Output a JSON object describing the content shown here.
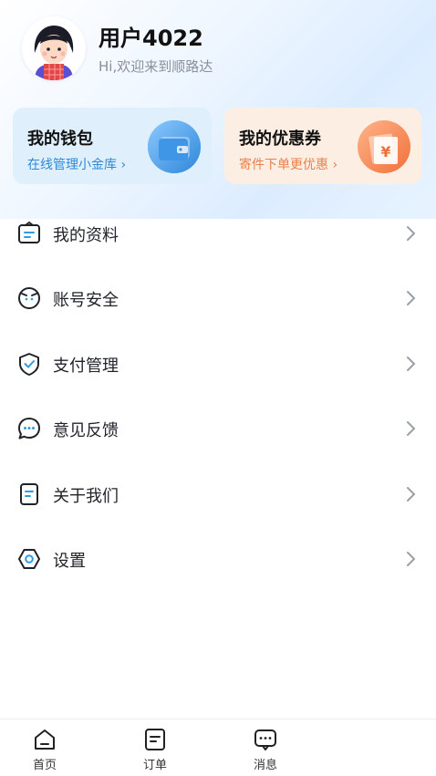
{
  "profile": {
    "username": "用户4022",
    "welcome": "Hi,欢迎来到顺路达",
    "avatar_icon": "user-avatar"
  },
  "cards": {
    "wallet": {
      "title": "我的钱包",
      "subtitle": "在线管理小金库 ›",
      "icon": "wallet-icon"
    },
    "coupon": {
      "title": "我的优惠券",
      "subtitle": "寄件下单更优惠 ›",
      "icon": "coupon-yen-icon"
    }
  },
  "menu": [
    {
      "label": "我的资料",
      "icon": "profile-id-icon"
    },
    {
      "label": "账号安全",
      "icon": "account-security-icon"
    },
    {
      "label": "支付管理",
      "icon": "payment-shield-icon"
    },
    {
      "label": "意见反馈",
      "icon": "feedback-chat-icon"
    },
    {
      "label": "关于我们",
      "icon": "about-doc-icon"
    },
    {
      "label": "设置",
      "icon": "settings-hex-icon"
    }
  ],
  "tabbar": [
    {
      "label": "首页",
      "icon": "home-icon"
    },
    {
      "label": "订单",
      "icon": "order-icon"
    },
    {
      "label": "消息",
      "icon": "message-icon"
    }
  ],
  "colors": {
    "accent_blue": "#2e89d6",
    "coupon_orange": "#e8814a",
    "text_primary": "#1f2329",
    "text_secondary": "#8a8f99"
  }
}
